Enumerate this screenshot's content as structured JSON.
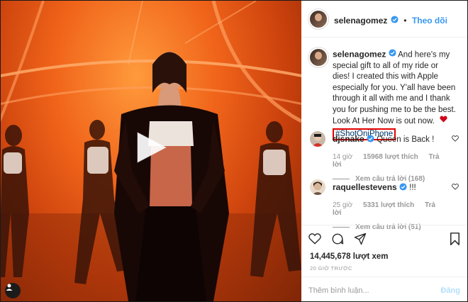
{
  "header": {
    "username": "selenagomez",
    "follow_label": "Theo dõi",
    "separator": "•"
  },
  "caption": {
    "username": "selenagomez",
    "text": "And here's my special gift to all of my ride or dies! I created this with Apple especially for you. Y'all have been through it all with me and I thank you for pushing me to be the best. Look At Her Now is out now.",
    "hashtag": "#ShotOniPhone",
    "highlight_color": "#e20000"
  },
  "comments": [
    {
      "username": "djsnake",
      "text": "Queen is Back !",
      "time": "14 giờ",
      "likes": "15968 lượt thích",
      "reply_label": "Trả lời",
      "view_replies": "Xem câu trả lời (168)"
    },
    {
      "username": "raquellestevens",
      "text": "!!!",
      "time": "25 giờ",
      "likes": "5331 lượt thích",
      "reply_label": "Trả lời",
      "view_replies": "Xem câu trả lời (51)"
    }
  ],
  "stats": {
    "views": "14,445,678 lượt xem",
    "timestamp": "20 GIỜ TRƯỚC"
  },
  "add_comment": {
    "placeholder": "Thêm bình luận...",
    "post_label": "Đăng"
  },
  "icons": [
    "heart-icon",
    "comment-icon",
    "share-icon",
    "bookmark-icon",
    "play-icon",
    "verified-icon"
  ],
  "colors": {
    "link": "#3897f0",
    "verified": "#3897f0",
    "post_disabled": "#b2dffc",
    "media_accent": "#f0641a"
  }
}
